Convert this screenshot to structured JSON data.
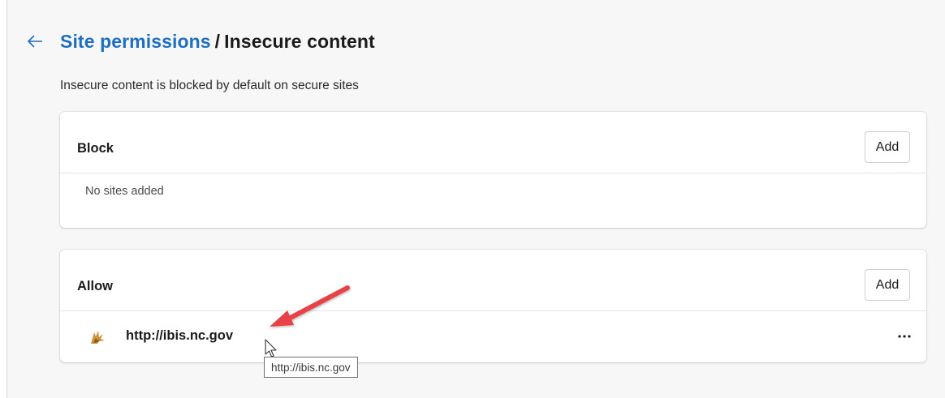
{
  "header": {
    "back_icon": "arrow-left-icon",
    "breadcrumb_link": "Site permissions",
    "separator": "/",
    "current_page": "Insecure content"
  },
  "description": "Insecure content is blocked by default on secure sites",
  "block_section": {
    "title": "Block",
    "add_label": "Add",
    "empty_text": "No sites added"
  },
  "allow_section": {
    "title": "Allow",
    "add_label": "Add",
    "sites": [
      {
        "url": "http://ibis.nc.gov",
        "favicon": "ibis-bird-favicon",
        "more_icon": "ellipsis-icon"
      }
    ]
  },
  "tooltip": "http://ibis.nc.gov",
  "colors": {
    "link": "#1f6fbf",
    "annotation_arrow": "#e8424a",
    "background": "#f7f7f7"
  }
}
